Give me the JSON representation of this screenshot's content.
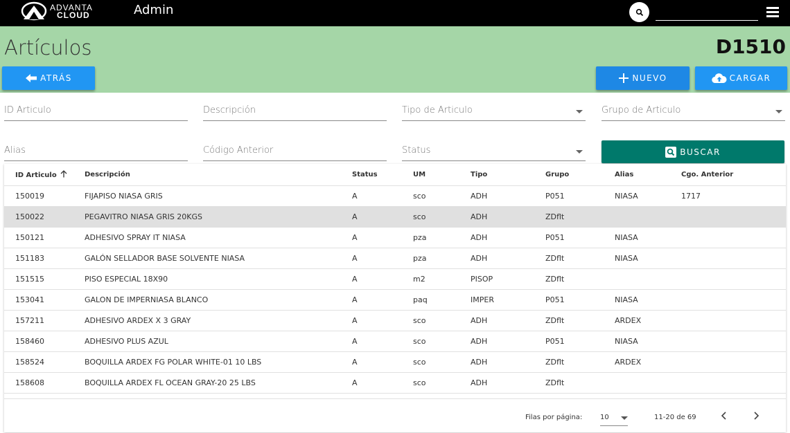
{
  "topbar": {
    "logo_line1": "ADVANTA",
    "logo_line2": "CLOUD",
    "app_title": "Admin",
    "search_value": ""
  },
  "header": {
    "title": "Artículos",
    "code": "D1510",
    "back_label": "ATRÁS",
    "new_label": "NUEVO",
    "upload_label": "CARGAR"
  },
  "filters": {
    "id_articulo": "ID Articulo",
    "descripcion": "Descripción",
    "tipo_articulo": "Tipo de Articulo",
    "grupo_articulo": "Grupo de Articulo",
    "alias": "Alias",
    "codigo_anterior": "Código Anterior",
    "status": "Status",
    "search_label": "BUSCAR"
  },
  "table": {
    "headers": [
      "ID Articulo",
      "Descripción",
      "Status",
      "UM",
      "Tipo",
      "Grupo",
      "Alias",
      "Cgo. Anterior"
    ],
    "rows": [
      [
        "150019",
        "FIJAPISO NIASA GRIS",
        "A",
        "sco",
        "ADH",
        "P051",
        "NIASA",
        "1717"
      ],
      [
        "150022",
        "PEGAVITRO NIASA GRIS 20KGS",
        "A",
        "sco",
        "ADH",
        "ZDflt",
        "",
        ""
      ],
      [
        "150121",
        "ADHESIVO SPRAY IT NIASA",
        "A",
        "pza",
        "ADH",
        "P051",
        "NIASA",
        ""
      ],
      [
        "151183",
        "GALÓN SELLADOR BASE SOLVENTE NIASA",
        "A",
        "pza",
        "ADH",
        "ZDflt",
        "NIASA",
        ""
      ],
      [
        "151515",
        "PISO ESPECIAL 18X90",
        "A",
        "m2",
        "PISOP",
        "ZDflt",
        "",
        ""
      ],
      [
        "153041",
        "GALON DE IMPERNIASA BLANCO",
        "A",
        "paq",
        "IMPER",
        "P051",
        "NIASA",
        ""
      ],
      [
        "157211",
        "ADHESIVO ARDEX X 3 GRAY",
        "A",
        "sco",
        "ADH",
        "ZDflt",
        "ARDEX",
        ""
      ],
      [
        "158460",
        "ADHESIVO PLUS AZUL",
        "A",
        "sco",
        "ADH",
        "P051",
        "NIASA",
        ""
      ],
      [
        "158524",
        "BOQUILLA ARDEX FG POLAR WHITE-01 10 LBS",
        "A",
        "sco",
        "ADH",
        "ZDflt",
        "ARDEX",
        ""
      ],
      [
        "158608",
        "BOQUILLA ARDEX FL OCEAN GRAY-20 25 LBS",
        "A",
        "sco",
        "ADH",
        "ZDflt",
        "",
        ""
      ]
    ],
    "selected_row": 1
  },
  "pager": {
    "rows_per_page_label": "Filas por página:",
    "rows_per_page": "10",
    "range": "11-20 de 69"
  },
  "colors": {
    "topbar": "#000000",
    "header": "#a5d6a7",
    "primary_button": "#2196f3",
    "search_button": "#00796b"
  }
}
